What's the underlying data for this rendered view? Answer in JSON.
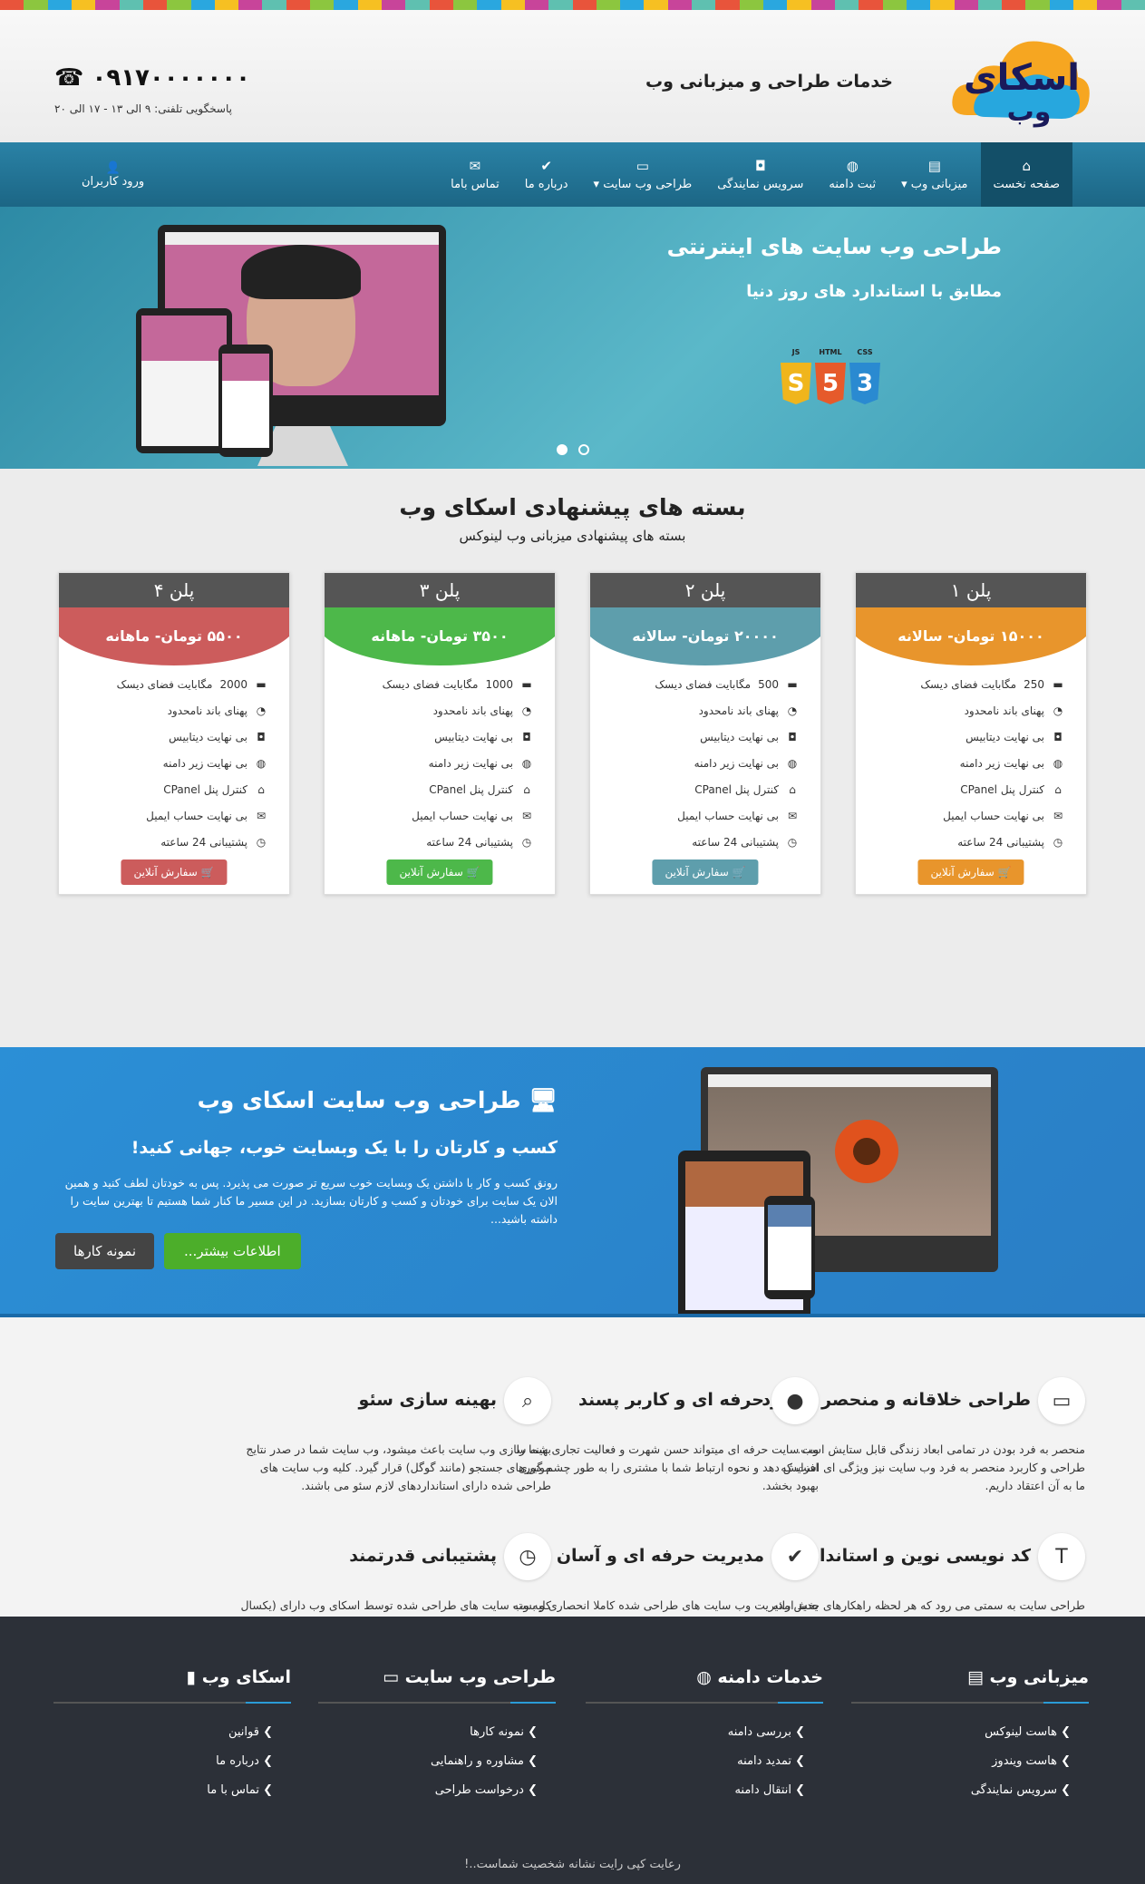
{
  "header": {
    "logo_text_top": "اسکای",
    "logo_text_bottom": "وب",
    "tagline": "خدمات طراحی و میزبانی وب",
    "phone": "۰۹۱۷۰۰۰۰۰۰۰",
    "hours": "پاسخگویی تلفنی: ۹ الی ۱۳ - ۱۷ الی ۲۰"
  },
  "nav": {
    "items": [
      {
        "label": "صفحه نخست",
        "icon": "home-icon"
      },
      {
        "label": "میزبانی وب",
        "icon": "server-icon",
        "dropdown": true
      },
      {
        "label": "ثبت دامنه",
        "icon": "globe-icon"
      },
      {
        "label": "سرویس نمایندگی",
        "icon": "hdd-icon"
      },
      {
        "label": "طراحی وب سایت",
        "icon": "monitor-icon",
        "dropdown": true
      },
      {
        "label": "درباره ما",
        "icon": "check-icon"
      },
      {
        "label": "تماس باما",
        "icon": "mail-icon"
      }
    ],
    "login": "ورود کاربران"
  },
  "hero": {
    "title": "طراحی وب سایت های اینترنتی",
    "subtitle": "مطابق با استاندارد های روز دنیا",
    "badges": [
      {
        "label": "JS",
        "num": "S",
        "color": "#f0b51c"
      },
      {
        "label": "HTML",
        "num": "5",
        "color": "#e65a2b"
      },
      {
        "label": "CSS",
        "num": "3",
        "color": "#2a8ad1"
      }
    ]
  },
  "plans": {
    "title": "بسته های پیشنهادی اسکای وب",
    "subtitle": "بسته های پیشنهادی میزبانی وب لینوکس",
    "cards": [
      {
        "name": "پلن ۱",
        "price": "۱۵۰۰۰ تومان- سالانه",
        "color": "#e8952c",
        "disk": "250"
      },
      {
        "name": "پلن ۲",
        "price": "۲۰۰۰۰ تومان- سالانه",
        "color": "#5e9eac",
        "disk": "500"
      },
      {
        "name": "پلن ۳",
        "price": "۳۵۰۰ تومان- ماهانه",
        "color": "#4db84a",
        "disk": "1000"
      },
      {
        "name": "پلن ۴",
        "price": "۵۵۰۰ تومان- ماهانه",
        "color": "#cc5c5c",
        "disk": "2000"
      }
    ],
    "features": [
      "مگابایت فضای دیسک",
      "پهنای باند نامحدود",
      "بی نهایت دیتابیس",
      "بی نهایت زیر دامنه",
      "کنترل پنل CPanel",
      "بی نهایت حساب ایمیل",
      "پشتیبانی 24 ساعته"
    ],
    "order_label": "سفارش آنلاین"
  },
  "webdesign": {
    "title": "طراحی وب سایت اسکای وب",
    "subtitle": "کسب و کارتان را با یک وبسایت خوب، جهانی کنید!",
    "body": "رونق کسب و کار با داشتن یک وبسایت خوب سریع تر صورت می پذیرد. پس به خودتان لطف کنید و همین الان یک سایت برای خودتان و کسب و کارتان بسازید. در این مسیر ما کنار شما هستیم تا بهترین سایت را داشته باشید...",
    "more_button": "اطلاعات بیشتر...",
    "portfolio_button": "نمونه کارها"
  },
  "features": [
    {
      "title": "طراحی خلاقانه و منحصر به فرد",
      "icon": "monitor-icon",
      "text": "منحصر به فرد بودن در تمامی ابعاد زندگی قابل ستایش است. طراحی و کاربرد منحصر به فرد وب سایت نیز ویژگی ای است که ما به آن اعتقاد داریم."
    },
    {
      "title": "حرفه ای و کاربر پسند",
      "icon": "user-icon",
      "text": "وب سایت حرفه ای میتواند حسن شهرت و فعالیت تجاری شما را افزایش دهد و نحوه ارتباط شما با مشتری را به طور چشم گیری بهبود بخشد."
    },
    {
      "title": "بهینه سازی سئو",
      "icon": "search-icon",
      "text": "بهینه سازی وب سایت باعث میشود، وب سایت شما در صدر نتایج موتورهای جستجو (مانند گوگل) قرار گیرد. کلیه وب سایت های طراحی شده دارای استانداردهای لازم سئو می باشند."
    },
    {
      "title": "کد نویسی نوین و استاندارد",
      "icon": "text-icon",
      "text": "طراحی سایت به سمتی می رود که هر لحظه راهکارهای جدید ارائه میشود. همواره سعی کرده ایم با جدیدترین روشهای برنامه نویسی تحت وب خدمات خود را ارائه دهیم."
    },
    {
      "title": "مدیریت حرفه ای و آسان وب",
      "icon": "check-icon",
      "text": "بخش مدیریت وب سایت های طراحی شده کاملا انحصاری و بسته به نیازهای وب سایت آماده و تحویل داده میشود."
    },
    {
      "title": "پشتیبانی قدرتمند",
      "icon": "clock-icon",
      "text": "کلیه وب سایت های طراحی شده توسط اسکای وب دارای (یکسال رایگان) پشتیبانی فنی، امنیتی و بروزرسانی بوده، تا اعتبار شما را تضمین کنیم."
    }
  ],
  "footer": {
    "columns": [
      {
        "title": "میزبانی وب",
        "icon": "server-icon",
        "links": [
          "هاست لینوکس",
          "هاست ویندوز",
          "سرویس نمایندگی"
        ]
      },
      {
        "title": "خدمات دامنه",
        "icon": "globe-icon",
        "links": [
          "بررسی دامنه",
          "تمدید دامنه",
          "انتقال دامنه"
        ]
      },
      {
        "title": "طراحی وب سایت",
        "icon": "monitor-icon",
        "links": [
          "نمونه کارها",
          "مشاوره و راهنمایی",
          "درخواست طراحی"
        ]
      },
      {
        "title": "اسکای وب",
        "icon": "bookmark-icon",
        "links": [
          "قوانین",
          "درباره ما",
          "تماس با ما"
        ]
      }
    ],
    "copyright": "رعایت کپی رایت نشانه شخصیت شماست..!"
  }
}
